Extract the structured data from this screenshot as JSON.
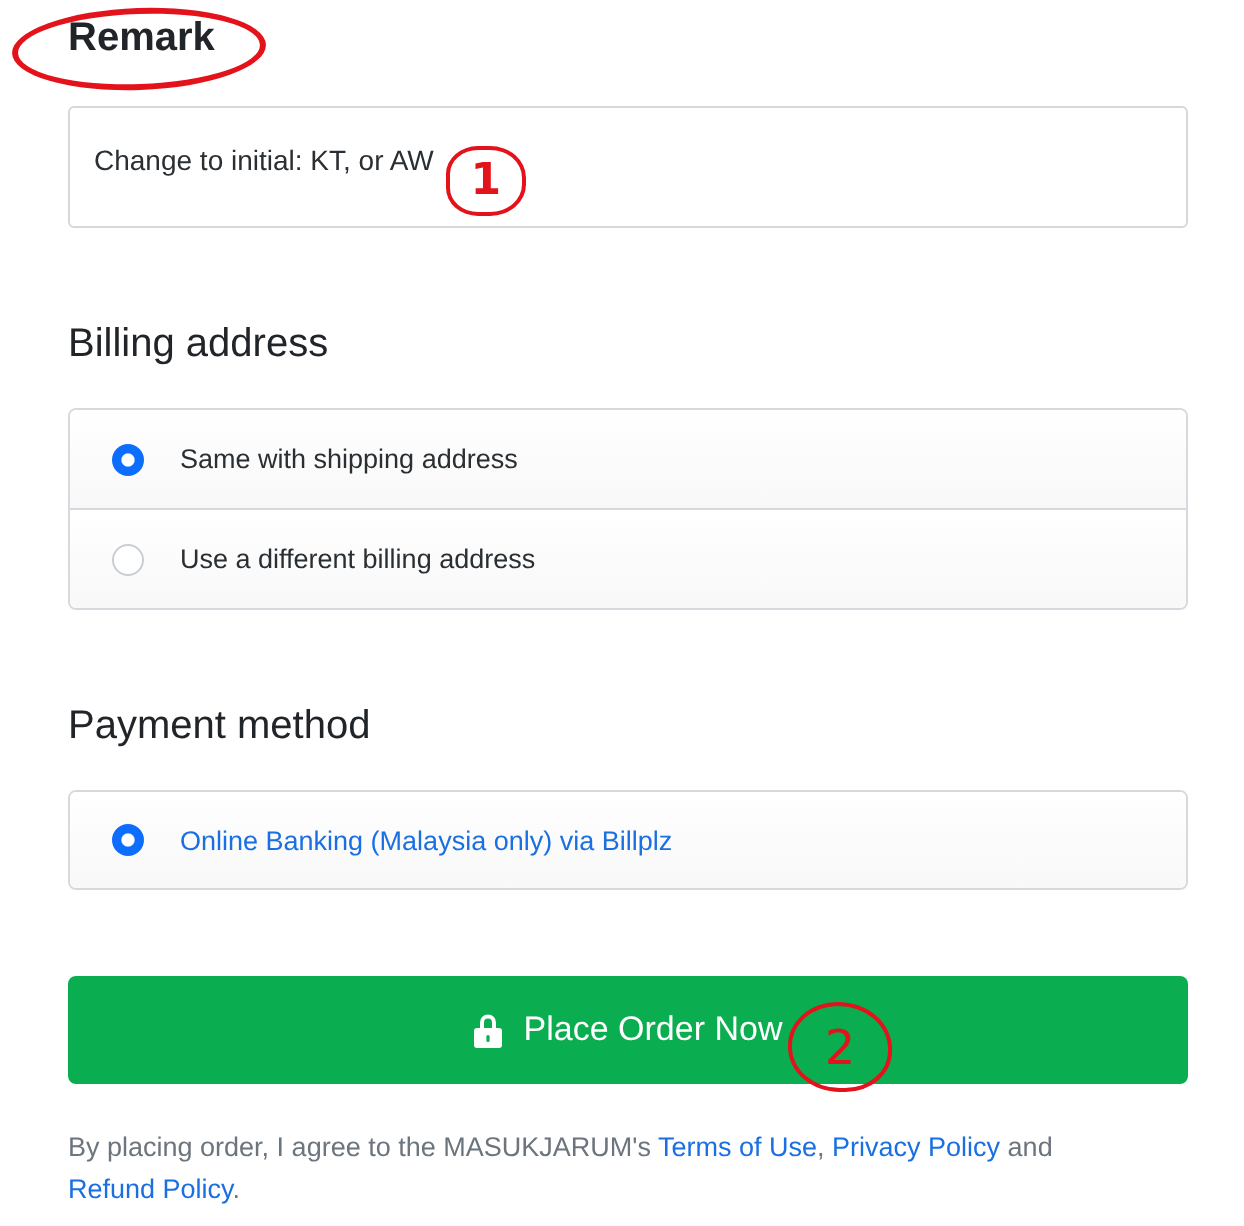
{
  "remark": {
    "heading": "Remark",
    "heading_circled": true,
    "value": "Change to initial: KT, or AW",
    "callout": "1"
  },
  "billing": {
    "heading": "Billing address",
    "options": [
      {
        "label": "Same with shipping address",
        "selected": true
      },
      {
        "label": "Use a different billing address",
        "selected": false
      }
    ]
  },
  "payment": {
    "heading": "Payment method",
    "options": [
      {
        "label": "Online Banking (Malaysia only) via Billplz",
        "selected": true
      }
    ]
  },
  "order_button": {
    "label": "Place Order Now",
    "callout": "2"
  },
  "agreement": {
    "parts": [
      {
        "kind": "text",
        "text": "By placing order, I agree to the MASUKJARUM's "
      },
      {
        "kind": "link",
        "text": "Terms of Use"
      },
      {
        "kind": "text",
        "text": ", "
      },
      {
        "kind": "link",
        "text": "Privacy Policy"
      },
      {
        "kind": "text",
        "text": " and "
      },
      {
        "kind": "link",
        "text": "Refund Policy"
      },
      {
        "kind": "text",
        "text": "."
      }
    ]
  }
}
